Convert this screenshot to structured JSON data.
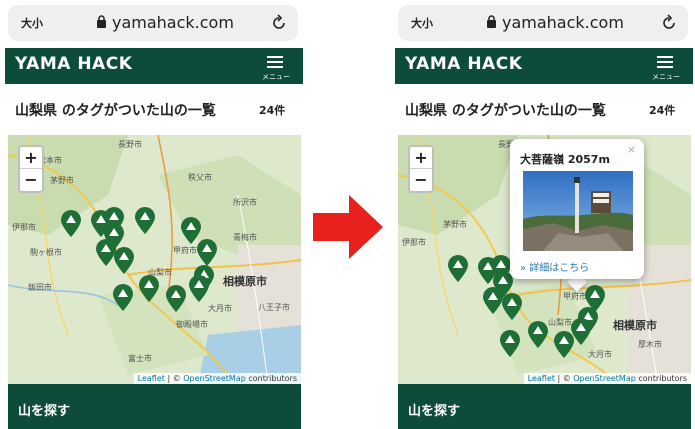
{
  "screens": [
    {
      "browser": {
        "text_size": "大小",
        "domain": "yamahack.com"
      },
      "header": {
        "logo": "YAMA HACK",
        "menu_label": "メニュー"
      },
      "title": "山梨県 のタグがついた山の一覧",
      "count": "24件",
      "map": {
        "zoom_in": "+",
        "zoom_out": "−",
        "attribution": {
          "leaflet": "Leaflet",
          "sep": " | © ",
          "osm": "OpenStreetMap",
          "rest": " contributors"
        },
        "places": [
          "長野市",
          "松本市",
          "茅野市",
          "甲府市",
          "相模原市",
          "青梅市",
          "所沢市",
          "飯田市",
          "富士市",
          "御殿場市",
          "伊那市",
          "駒ヶ根市",
          "山梨市",
          "大月市",
          "八王子市",
          "秩父市"
        ]
      },
      "footer": {
        "label": "山を探す"
      }
    },
    {
      "browser": {
        "text_size": "大小",
        "domain": "yamahack.com"
      },
      "header": {
        "logo": "YAMA HACK",
        "menu_label": "メニュー"
      },
      "title": "山梨県 のタグがついた山の一覧",
      "count": "24件",
      "map": {
        "zoom_in": "+",
        "zoom_out": "−",
        "attribution": {
          "leaflet": "Leaflet",
          "sep": " | © ",
          "osm": "OpenStreetMap",
          "rest": " contributors"
        },
        "places": [
          "長野市",
          "茅野市",
          "甲府市",
          "相模原市",
          "厚木市",
          "伊那市",
          "山梨市",
          "大月市"
        ]
      },
      "popup": {
        "title": "大菩薩嶺 2057m",
        "link": "» 詳細はこちら",
        "close": "×"
      },
      "footer": {
        "label": "山を探す"
      }
    }
  ],
  "colors": {
    "brand_green": "#0d4c3b",
    "pin_green": "#1f6e35",
    "arrow_red": "#e8211d",
    "link_blue": "#2a7ab0"
  },
  "icons": [
    "lock-icon",
    "reload-icon",
    "hamburger-menu-icon",
    "mountain-pin-icon",
    "close-icon",
    "right-arrow-icon"
  ]
}
